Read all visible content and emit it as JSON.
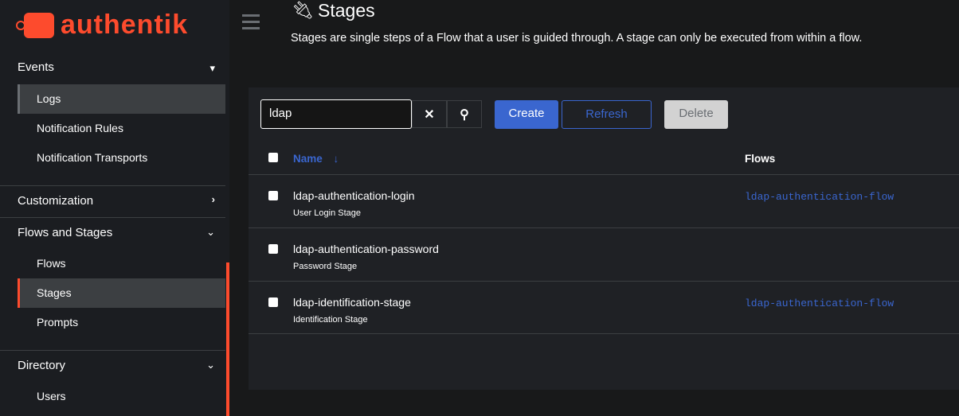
{
  "brand": "authentik",
  "sidebar": {
    "events": "Events",
    "events_items": [
      "Logs",
      "Notification Rules",
      "Notification Transports"
    ],
    "customization": "Customization",
    "flows_and_stages": "Flows and Stages",
    "flows_items": [
      "Flows",
      "Stages",
      "Prompts"
    ],
    "directory": "Directory",
    "directory_items": [
      "Users"
    ]
  },
  "page": {
    "title": "Stages",
    "description": "Stages are single steps of a Flow that a user is guided through. A stage can only be executed from within a flow."
  },
  "toolbar": {
    "search_value": "ldap",
    "create": "Create",
    "refresh": "Refresh",
    "delete": "Delete"
  },
  "table": {
    "col_name": "Name",
    "col_flows": "Flows",
    "rows": [
      {
        "name": "ldap-authentication-login",
        "type": "User Login Stage",
        "flow": "ldap-authentication-flow"
      },
      {
        "name": "ldap-authentication-password",
        "type": "Password Stage",
        "flow": ""
      },
      {
        "name": "ldap-identification-stage",
        "type": "Identification Stage",
        "flow": "ldap-authentication-flow"
      }
    ]
  },
  "colors": {
    "accent": "#fd4b2d",
    "primary": "#3a66cf"
  }
}
